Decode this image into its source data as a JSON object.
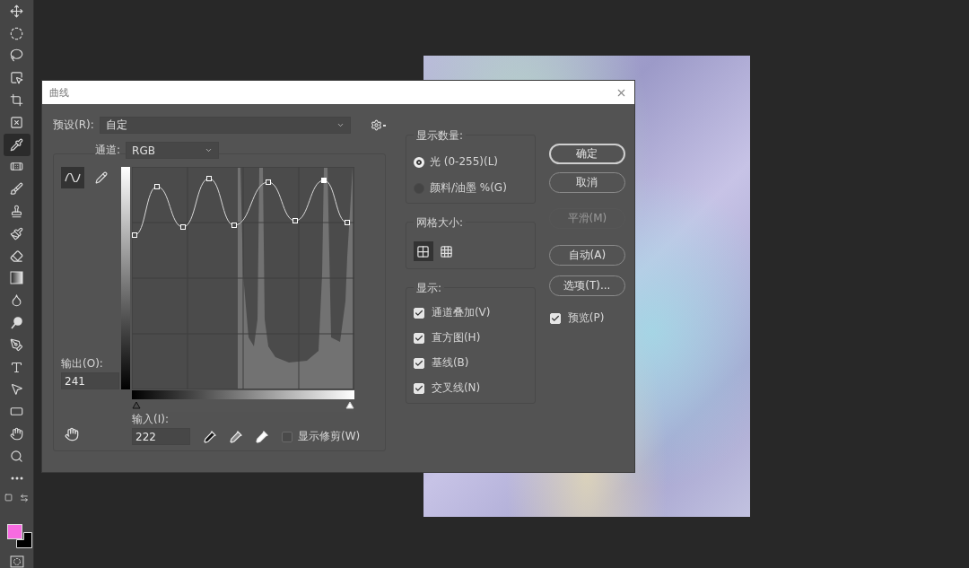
{
  "toolbar": {
    "tools": [
      {
        "kind": "move",
        "selected": false
      },
      {
        "kind": "ellipse-marquee",
        "selected": false
      },
      {
        "kind": "lasso",
        "selected": false
      },
      {
        "kind": "object-select",
        "selected": false
      },
      {
        "kind": "crop",
        "selected": false
      },
      {
        "kind": "frame",
        "selected": false
      },
      {
        "kind": "eyedropper",
        "selected": true
      },
      {
        "kind": "healing",
        "selected": false
      },
      {
        "kind": "brush",
        "selected": false
      },
      {
        "kind": "stamp",
        "selected": false
      },
      {
        "kind": "history-brush",
        "selected": false
      },
      {
        "kind": "eraser",
        "selected": false
      },
      {
        "kind": "gradient",
        "selected": false
      },
      {
        "kind": "blur",
        "selected": false
      },
      {
        "kind": "dodge",
        "selected": false
      },
      {
        "kind": "pen",
        "selected": false
      },
      {
        "kind": "type",
        "selected": false
      },
      {
        "kind": "path-select",
        "selected": false
      },
      {
        "kind": "rectangle",
        "selected": false
      },
      {
        "kind": "hand",
        "selected": false
      },
      {
        "kind": "zoom",
        "selected": false
      },
      {
        "kind": "more",
        "selected": false
      }
    ],
    "swatches": [
      {
        "color": "#f76be0"
      },
      {
        "color": "#000000"
      }
    ]
  },
  "dialog": {
    "title": "曲线",
    "preset": {
      "label": "预设(R):",
      "value": "自定"
    },
    "channel": {
      "label": "通道:",
      "value": "RGB"
    },
    "curve_tools": [
      {
        "kind": "curve",
        "selected": true
      },
      {
        "kind": "pencil",
        "selected": false
      }
    ],
    "output": {
      "label": "输出(O):",
      "value": "241"
    },
    "input": {
      "label": "输入(I):",
      "value": "222"
    },
    "input_sliders": [
      {
        "kind": "black-point",
        "level": 0
      },
      {
        "kind": "white-point",
        "level": 1
      }
    ],
    "show_clipping": {
      "label": "显示修剪(W)",
      "checked": false
    },
    "display_amount": {
      "title": "显示数量:",
      "options": [
        {
          "label": "光 (0-255)(L)",
          "selected": true
        },
        {
          "label": "颜料/油墨 %(G)",
          "selected": false
        }
      ]
    },
    "grid_size": {
      "title": "网格大小:",
      "options": [
        {
          "kind": "coarse",
          "selected": true
        },
        {
          "kind": "fine",
          "selected": false
        }
      ]
    },
    "show": {
      "title": "显示:",
      "options": [
        {
          "label": "通道叠加(V)",
          "checked": true
        },
        {
          "label": "直方图(H)",
          "checked": true
        },
        {
          "label": "基线(B)",
          "checked": true
        },
        {
          "label": "交叉线(N)",
          "checked": true
        }
      ]
    },
    "buttons": [
      {
        "label": "确定",
        "kind": "default",
        "disabled": false
      },
      {
        "label": "取消",
        "kind": "normal",
        "disabled": false
      },
      {
        "label": "平滑(M)",
        "kind": "normal",
        "disabled": true
      },
      {
        "label": "自动(A)",
        "kind": "normal",
        "disabled": false
      },
      {
        "label": "选项(T)...",
        "kind": "normal",
        "disabled": false
      }
    ],
    "preview": {
      "label": "预览(P)",
      "checked": true
    }
  }
}
